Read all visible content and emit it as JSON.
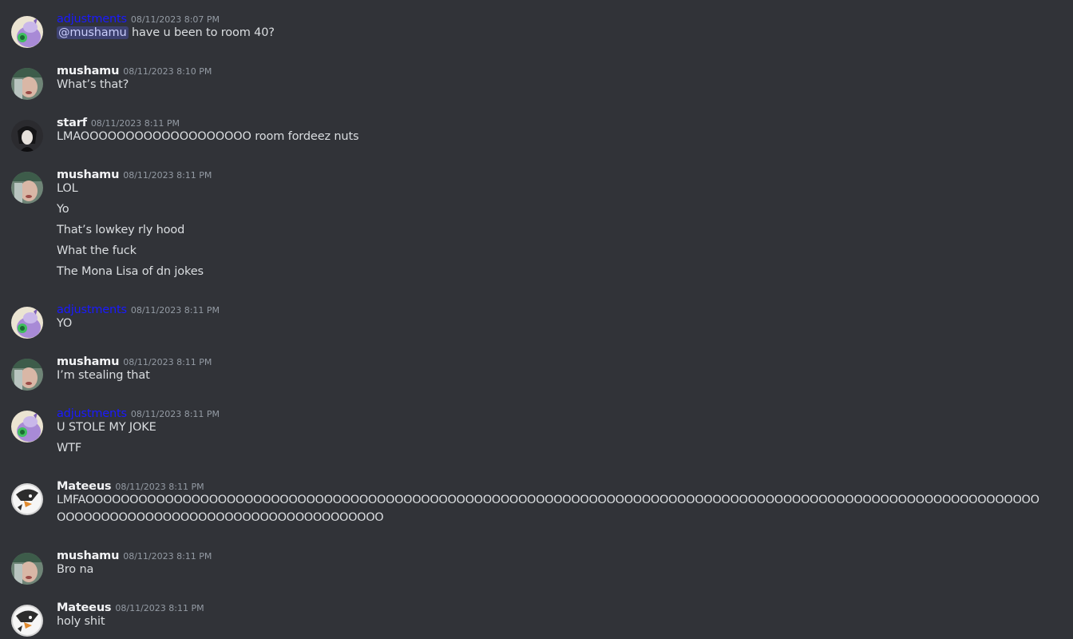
{
  "colors": {
    "background": "#313338",
    "author_default": "#f2f3f5",
    "author_adjustments": "#1a1aff",
    "timestamp": "#949ba4",
    "message_text": "#dbdee1",
    "mention_bg": "#5865f24d"
  },
  "messages": [
    {
      "author": "adjustments",
      "avatar": "goodra-avatar",
      "timestamp": "08/11/2023 8:07 PM",
      "mention": "@mushamu",
      "lines": [
        " have u been to room 40?"
      ]
    },
    {
      "author": "mushamu",
      "avatar": "photo-avatar",
      "timestamp": "08/11/2023 8:10 PM",
      "lines": [
        "What’s that?"
      ]
    },
    {
      "author": "starf",
      "avatar": "anime-character-avatar",
      "timestamp": "08/11/2023 8:11 PM",
      "lines": [
        "LMAOOOOOOOOOOOOOOOOOOO room fordeez nuts"
      ]
    },
    {
      "author": "mushamu",
      "avatar": "photo-avatar",
      "timestamp": "08/11/2023 8:11 PM",
      "lines": [
        "LOL",
        "Yo",
        "That’s lowkey rly hood",
        "What the fuck",
        "The Mona Lisa of dn jokes"
      ]
    },
    {
      "author": "adjustments",
      "avatar": "goodra-avatar",
      "timestamp": "08/11/2023 8:11 PM",
      "lines": [
        "YO"
      ]
    },
    {
      "author": "mushamu",
      "avatar": "photo-avatar",
      "timestamp": "08/11/2023 8:11 PM",
      "lines": [
        "I’m stealing that"
      ]
    },
    {
      "author": "adjustments",
      "avatar": "goodra-avatar",
      "timestamp": "08/11/2023 8:11 PM",
      "lines": [
        "U STOLE MY JOKE",
        "WTF"
      ]
    },
    {
      "author": "Mateeus",
      "avatar": "penguin-avatar",
      "timestamp": "08/11/2023 8:11 PM",
      "lines": [
        "LMFAOOOOOOOOOOOOOOOOOOOOOOOOOOOOOOOOOOOOOOOOOOOOOOOOOOOOOOOOOOOOOOOOOOOOOOOOOOOOOOOOOOOOOOOOOOOOOOOOOOOOOOOOOOOOOOOOOOOOOOOOOOOOOOOOOOOOOOOOOOOOOOOOO"
      ]
    },
    {
      "author": "mushamu",
      "avatar": "photo-avatar",
      "timestamp": "08/11/2023 8:11 PM",
      "lines": [
        "Bro na"
      ]
    },
    {
      "author": "Mateeus",
      "avatar": "penguin-avatar",
      "timestamp": "08/11/2023 8:11 PM",
      "lines": [
        "holy shit"
      ]
    }
  ]
}
